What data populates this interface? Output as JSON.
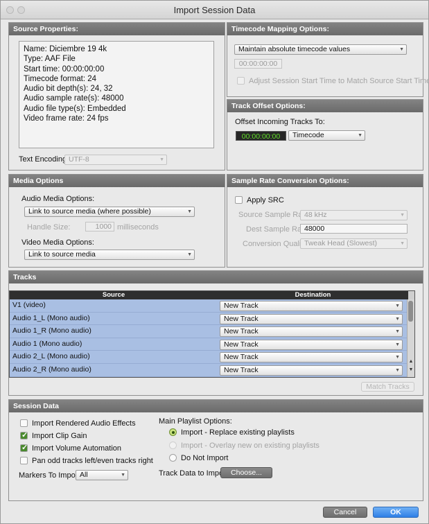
{
  "window": {
    "title": "Import Session Data"
  },
  "source_properties": {
    "header": "Source Properties:",
    "info": [
      "Name: Diciembre 19 4k",
      "Type: AAF File",
      "Start time: 00:00:00:00",
      "Timecode format: 24",
      "Audio bit depth(s): 24, 32",
      "Audio sample rate(s): 48000",
      "Audio file type(s): Embedded",
      "Video frame rate: 24 fps"
    ],
    "text_encoding_label": "Text Encoding:",
    "text_encoding_value": "UTF-8"
  },
  "timecode_mapping": {
    "header": "Timecode Mapping Options:",
    "option": "Maintain absolute timecode values",
    "timecode": "00:00:00:00",
    "adjust_label": "Adjust Session Start Time to Match Source Start Time"
  },
  "track_offset": {
    "header": "Track Offset Options:",
    "label": "Offset Incoming Tracks To:",
    "timecode": "00:00:00:00",
    "format": "Timecode"
  },
  "media_options": {
    "header": "Media Options",
    "audio_label": "Audio Media Options:",
    "audio_value": "Link to source media (where possible)",
    "handle_label": "Handle Size:",
    "handle_value": "1000",
    "handle_unit": "milliseconds",
    "video_label": "Video Media Options:",
    "video_value": "Link to source media"
  },
  "src": {
    "header": "Sample Rate Conversion Options:",
    "apply_label": "Apply SRC",
    "source_rate_label": "Source Sample Rate:",
    "source_rate_value": "48 kHz",
    "dest_rate_label": "Dest Sample Rate:",
    "dest_rate_value": "48000",
    "quality_label": "Conversion Quality:",
    "quality_value": "Tweak Head (Slowest)"
  },
  "tracks": {
    "header": "Tracks",
    "col_source": "Source",
    "col_destination": "Destination",
    "rows": [
      {
        "source": "V1 (video)",
        "destination": "New Track"
      },
      {
        "source": "Audio 1_L (Mono audio)",
        "destination": "New Track"
      },
      {
        "source": "Audio 1_R (Mono audio)",
        "destination": "New Track"
      },
      {
        "source": "Audio 1 (Mono audio)",
        "destination": "New Track"
      },
      {
        "source": "Audio 2_L (Mono audio)",
        "destination": "New Track"
      },
      {
        "source": "Audio 2_R (Mono audio)",
        "destination": "New Track"
      }
    ],
    "match_button": "Match Tracks"
  },
  "session_data": {
    "header": "Session Data",
    "checkboxes": [
      {
        "label": "Import Rendered Audio Effects",
        "checked": false
      },
      {
        "label": "Import Clip Gain",
        "checked": true
      },
      {
        "label": "Import Volume Automation",
        "checked": true
      },
      {
        "label": "Pan odd tracks left/even tracks right",
        "checked": false
      }
    ],
    "markers_label": "Markers To Import:",
    "markers_value": "All",
    "playlist_label": "Main Playlist Options:",
    "playlist_options": [
      {
        "label": "Import - Replace existing playlists",
        "selected": true,
        "enabled": true
      },
      {
        "label": "Import - Overlay new on existing playlists",
        "selected": false,
        "enabled": false
      },
      {
        "label": "Do Not Import",
        "selected": false,
        "enabled": true
      }
    ],
    "track_data_label": "Track Data to Import:",
    "choose_button": "Choose..."
  },
  "footer": {
    "cancel": "Cancel",
    "ok": "OK"
  }
}
